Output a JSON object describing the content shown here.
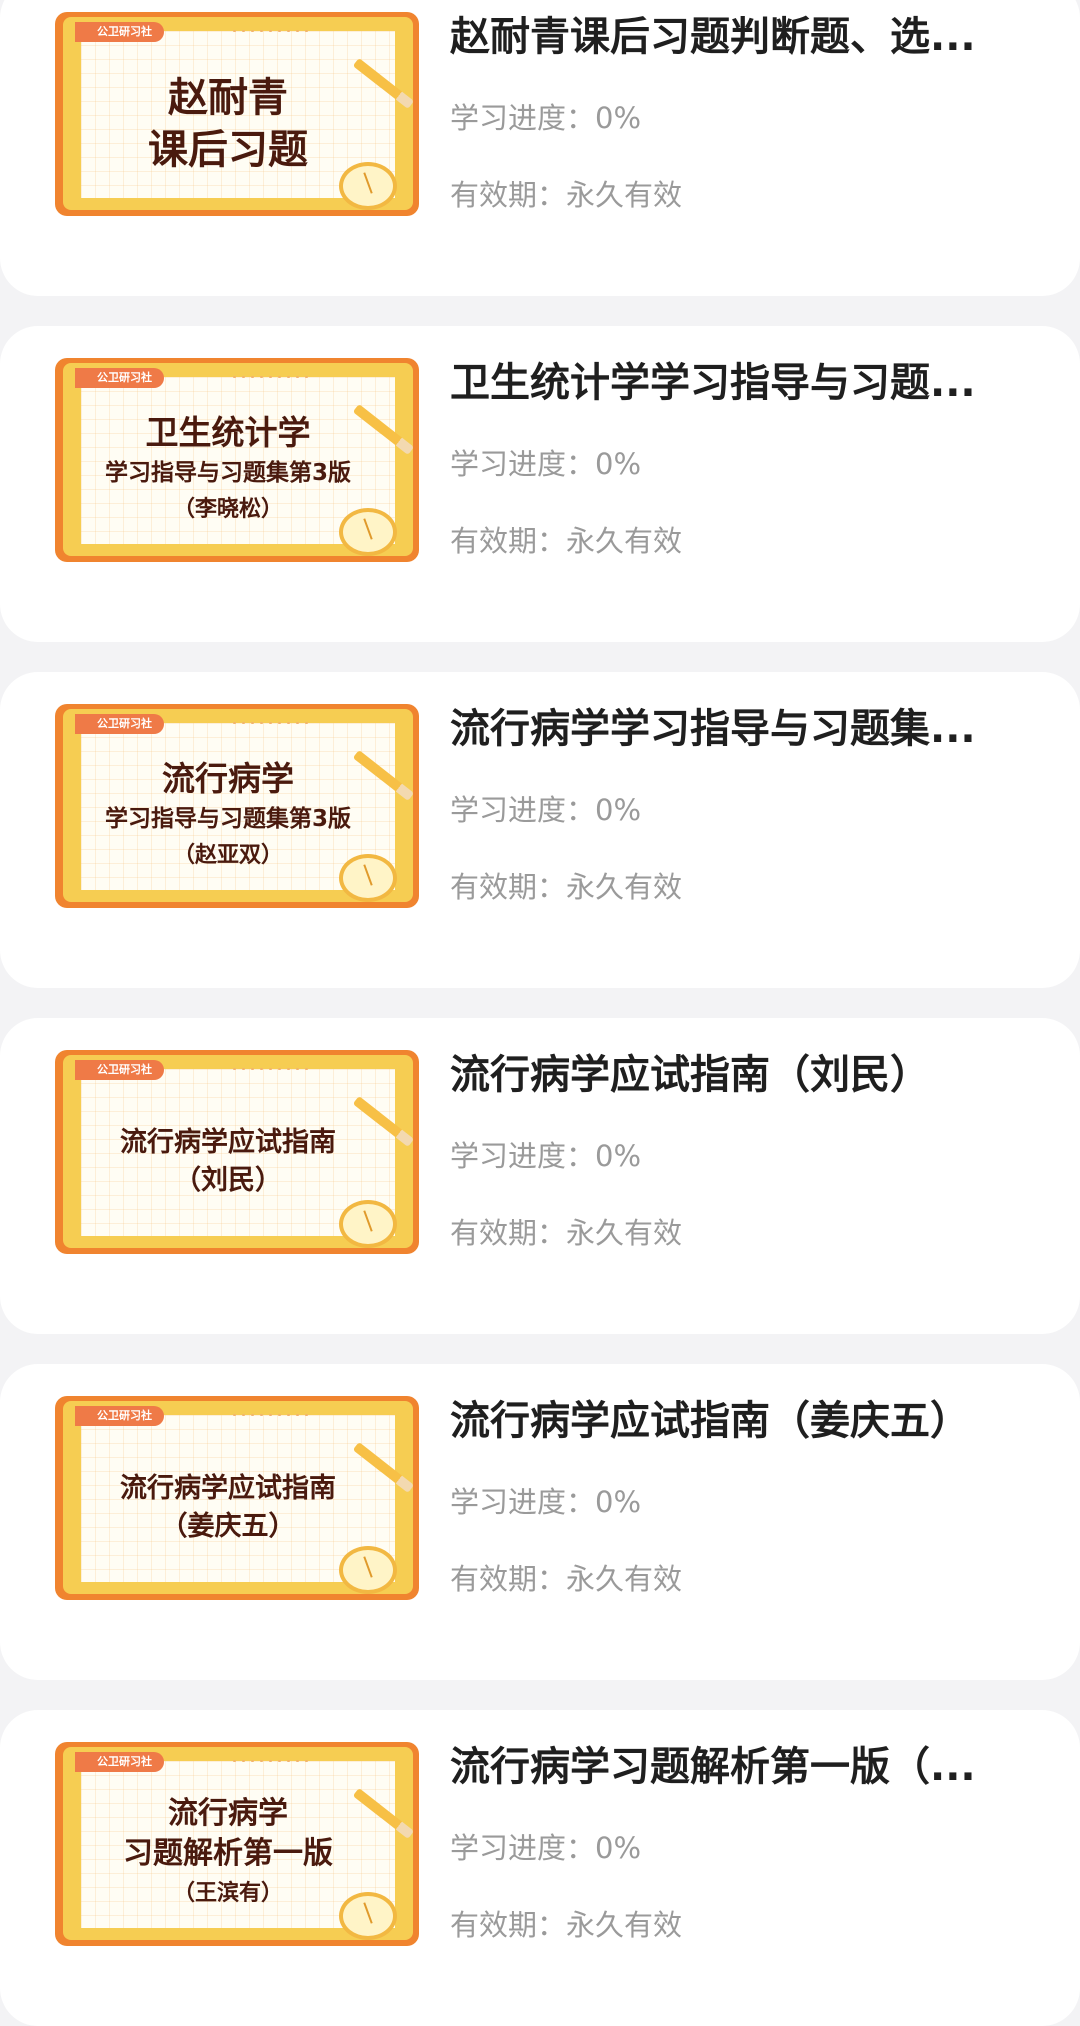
{
  "courses": [
    {
      "title": "赵耐青课后习题判断题、选...",
      "cover_brand": "公卫研习社",
      "cover_lines": [
        "赵耐青",
        "课后习题"
      ],
      "cover_style": "lg",
      "progress_label": "学习进度：",
      "progress_value": "0%",
      "validity_label": "有效期：",
      "validity_value": "永久有效"
    },
    {
      "title": "卫生统计学学习指导与习题...",
      "cover_brand": "公卫研习社",
      "cover_lines": [
        "卫生统计学",
        "学习指导与习题集第3版",
        "（李晓松）"
      ],
      "cover_style": "md",
      "progress_label": "学习进度：",
      "progress_value": "0%",
      "validity_label": "有效期：",
      "validity_value": "永久有效"
    },
    {
      "title": "流行病学学习指导与习题集...",
      "cover_brand": "公卫研习社",
      "cover_lines": [
        "流行病学",
        "学习指导与习题集第3版",
        "（赵亚双）"
      ],
      "cover_style": "md",
      "progress_label": "学习进度：",
      "progress_value": "0%",
      "validity_label": "有效期：",
      "validity_value": "永久有效"
    },
    {
      "title": "流行病学应试指南（刘民）",
      "cover_brand": "公卫研习社",
      "cover_lines": [
        "流行病学应试指南",
        "（刘民）"
      ],
      "cover_style": "sm",
      "progress_label": "学习进度：",
      "progress_value": "0%",
      "validity_label": "有效期：",
      "validity_value": "永久有效"
    },
    {
      "title": "流行病学应试指南（姜庆五）",
      "cover_brand": "公卫研习社",
      "cover_lines": [
        "流行病学应试指南",
        "（姜庆五）"
      ],
      "cover_style": "sm",
      "progress_label": "学习进度：",
      "progress_value": "0%",
      "validity_label": "有效期：",
      "validity_value": "永久有效"
    },
    {
      "title": "流行病学习题解析第一版（...",
      "cover_brand": "公卫研习社",
      "cover_lines": [
        "流行病学",
        "习题解析第一版",
        "（王滨有）"
      ],
      "cover_style": "mix",
      "progress_label": "学习进度：",
      "progress_value": "0%",
      "validity_label": "有效期：",
      "validity_value": "永久有效"
    }
  ]
}
